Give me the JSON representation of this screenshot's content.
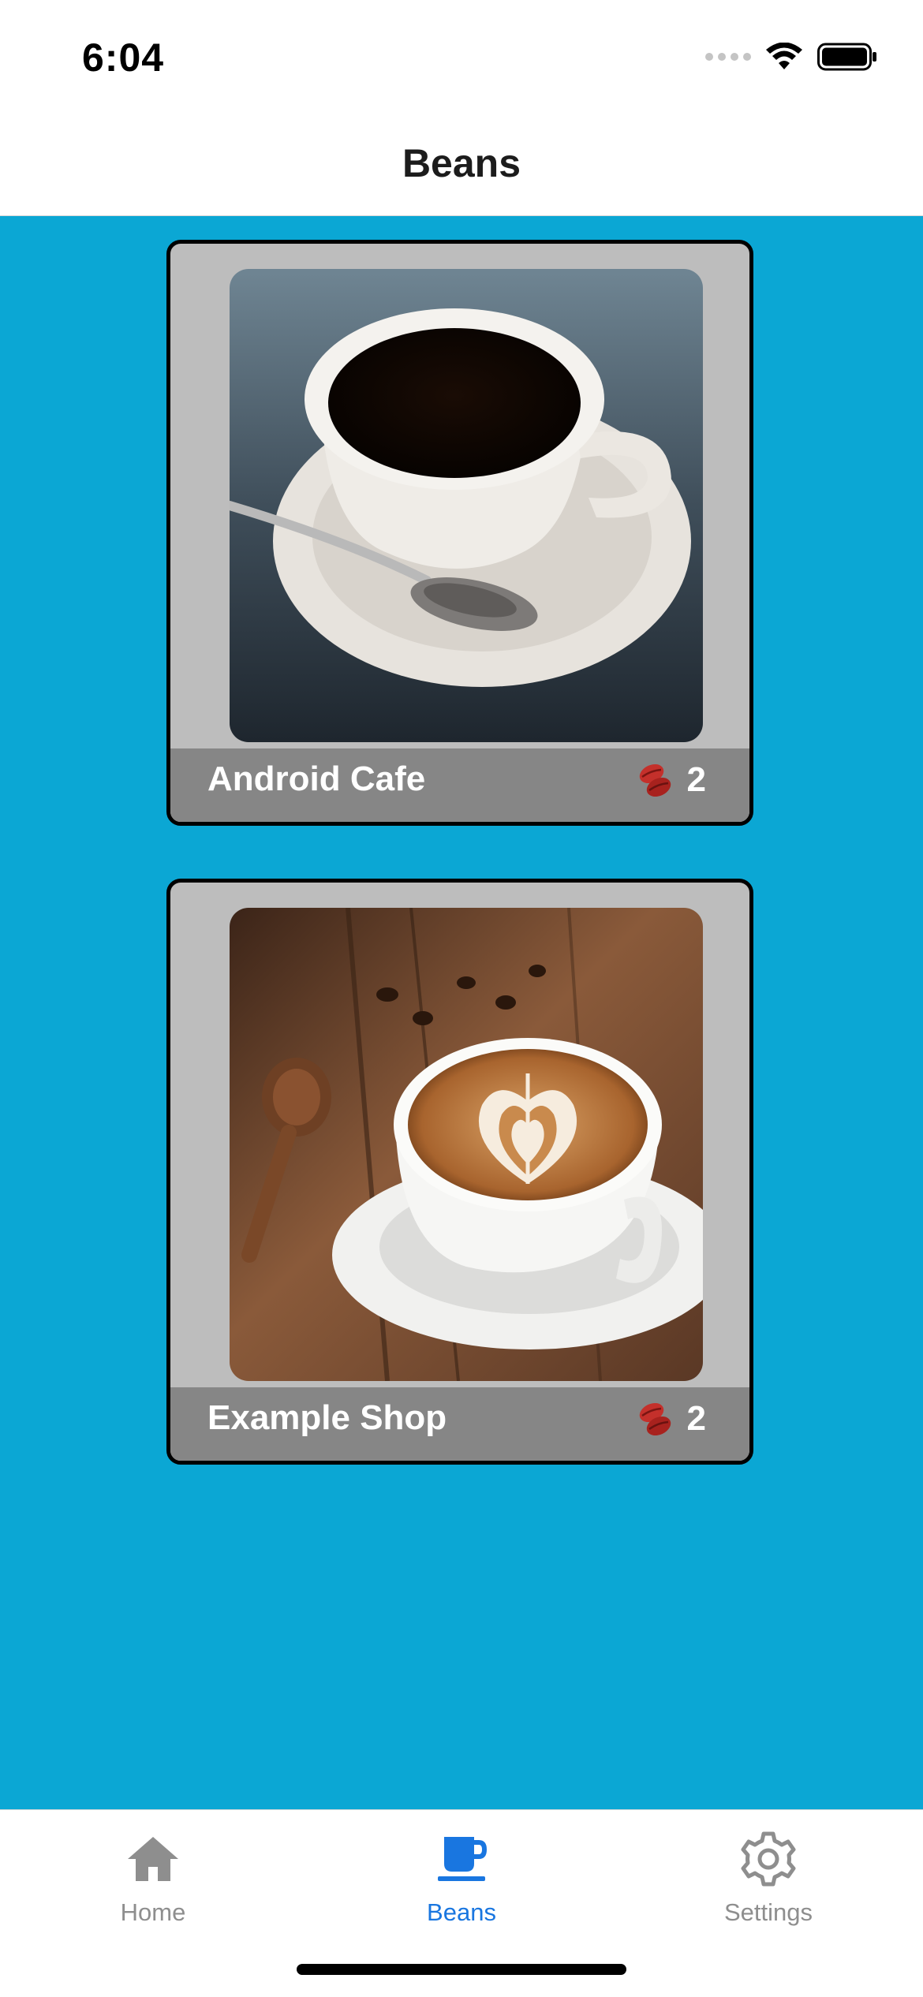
{
  "status_bar": {
    "time": "6:04"
  },
  "header": {
    "title": "Beans"
  },
  "shops": [
    {
      "name": "Android Cafe",
      "count": "2",
      "image": "black-coffee-cup-photo"
    },
    {
      "name": "Example Shop",
      "count": "2",
      "image": "latte-art-cup-photo"
    }
  ],
  "tabs": [
    {
      "label": "Home",
      "icon": "home-icon",
      "active": false
    },
    {
      "label": "Beans",
      "icon": "coffee-cup-icon",
      "active": true
    },
    {
      "label": "Settings",
      "icon": "gear-icon",
      "active": false
    }
  ],
  "colors": {
    "content_background": "#0ba7d4",
    "card_background": "#bdbdbd",
    "card_footer": "#868686",
    "tab_active": "#1976e0",
    "tab_inactive": "#8e8e8e"
  }
}
